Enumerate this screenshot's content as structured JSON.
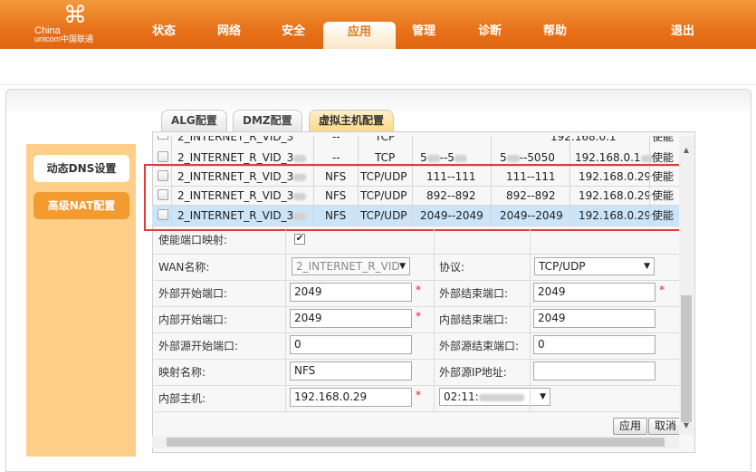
{
  "brand": {
    "name_line1": "China",
    "name_line2": "unicom中国联通",
    "logo_icon": "knot-icon"
  },
  "nav": [
    "状态",
    "网络",
    "安全",
    "应用",
    "管理",
    "诊断",
    "帮助",
    "退出"
  ],
  "subtabs": [
    "ALG配置",
    "DMZ配置",
    "虚拟主机配置"
  ],
  "sidebar": [
    "动态DNS设置",
    "高级NAT配置"
  ],
  "table": {
    "partial_row": [
      "2_INTERNET_R_VID_3",
      "--",
      "TCP",
      "5",
      "--5",
      "5",
      "--5050",
      "192.168.0.1",
      "使能"
    ],
    "rows": [
      [
        "2_INTERNET_R_VID_3",
        "NFS",
        "TCP/UDP",
        "111--111",
        "111--111",
        "192.168.0.29",
        "使能"
      ],
      [
        "2_INTERNET_R_VID_3",
        "NFS",
        "TCP/UDP",
        "892--892",
        "892--892",
        "192.168.0.29",
        "使能"
      ],
      [
        "2_INTERNET_R_VID_3",
        "NFS",
        "TCP/UDP",
        "2049--2049",
        "2049--2049",
        "192.168.0.29",
        "使能"
      ]
    ]
  },
  "form": {
    "enable_label": "使能端口映射:",
    "wan_label": "WAN名称:",
    "wan_value": "2_INTERNET_R_VID",
    "protocol_label": "协议:",
    "protocol_value": "TCP/UDP",
    "ext_start_label": "外部开始端口:",
    "ext_start_value": "2049",
    "ext_end_label": "外部结束端口:",
    "ext_end_value": "2049",
    "int_start_label": "内部开始端口:",
    "int_start_value": "2049",
    "int_end_label": "内部结束端口:",
    "int_end_value": "2049",
    "src_start_label": "外部源开始端口:",
    "src_start_value": "0",
    "src_end_label": "外部源结束端口:",
    "src_end_value": "0",
    "map_name_label": "映射名称:",
    "map_name_value": "NFS",
    "src_ip_label": "外部源IP地址:",
    "src_ip_value": "",
    "host_label": "内部主机:",
    "host_value": "192.168.0.29",
    "mac_value": "02:11:",
    "required_mark": "*"
  },
  "buttons": {
    "apply": "应用",
    "cancel": "取消"
  },
  "colors": {
    "header_orange": "#e8721a",
    "highlight_red": "#e23b3b",
    "selected_row": "#cbe4f8"
  }
}
